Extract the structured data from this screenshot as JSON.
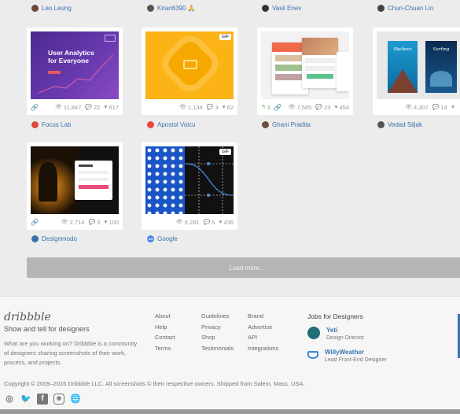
{
  "top_authors": [
    {
      "name": "Leo Leung",
      "color": "#6a4b3a"
    },
    {
      "name": "Kiran6390 🙏",
      "color": "#555555"
    },
    {
      "name": "Vasil Enev",
      "color": "#333333"
    },
    {
      "name": "Chun-Chuan Lin",
      "color": "#444444"
    }
  ],
  "shots": [
    {
      "title_lines": [
        "User Analytics",
        "for Everyone"
      ],
      "views": "11,847",
      "comments": "22",
      "likes": "617",
      "author": "Focus Lab",
      "author_color": "#e04a3a",
      "gif": false
    },
    {
      "views": "1,134",
      "comments": "3",
      "likes": "62",
      "author": "Apostol Voicu",
      "author_color": "#e94545",
      "gif": true,
      "gif_label": "GIF"
    },
    {
      "rebounds": "1",
      "views": "7,585",
      "comments": "23",
      "likes": "454",
      "author": "Ghani Pradita",
      "author_color": "#6b4f3d",
      "gif": false
    },
    {
      "panel_labels": [
        "Skylines",
        "Surfing"
      ],
      "views": "4,307",
      "comments": "14",
      "likes": "",
      "author": "Vedad Siljak",
      "author_color": "#555555",
      "gif": false
    },
    {
      "views": "2,714",
      "comments": "3",
      "likes": "100",
      "author": "Designmodo",
      "author_color": "#3a72b0",
      "gif": false
    },
    {
      "views": "9,281",
      "comments": "6",
      "likes": "436",
      "author": "Google",
      "author_color": "#4a86e8",
      "gif": true,
      "gif_label": "GIF",
      "author_badge": "GO"
    }
  ],
  "load_more": "Load more...",
  "footer": {
    "logo": "dribbble",
    "tagline": "Show and tell for designers",
    "blurb": "What are you working on? Dribbble is a community of designers sharing screenshots of their work, process, and projects.",
    "col1": [
      "About",
      "Help",
      "Contact",
      "Terms"
    ],
    "col2": [
      "Guidelines",
      "Privacy",
      "Shop",
      "Testimonials"
    ],
    "col3": [
      "Brand",
      "Advertise",
      "API",
      "Integrations"
    ],
    "jobs_title": "Jobs for Designers",
    "jobs": [
      {
        "company": "Yeti",
        "role": "Design Director"
      },
      {
        "company": "WillyWeather",
        "role": "Lead Front-End Designer"
      }
    ],
    "copyright": "Copyright © 2009–2016 Dribbble LLC. All screenshots © their respective owners. Shipped from Salem, Mass. USA."
  },
  "colors": {
    "link": "#3a72b0",
    "load_more_bg": "#b5b5b5"
  }
}
